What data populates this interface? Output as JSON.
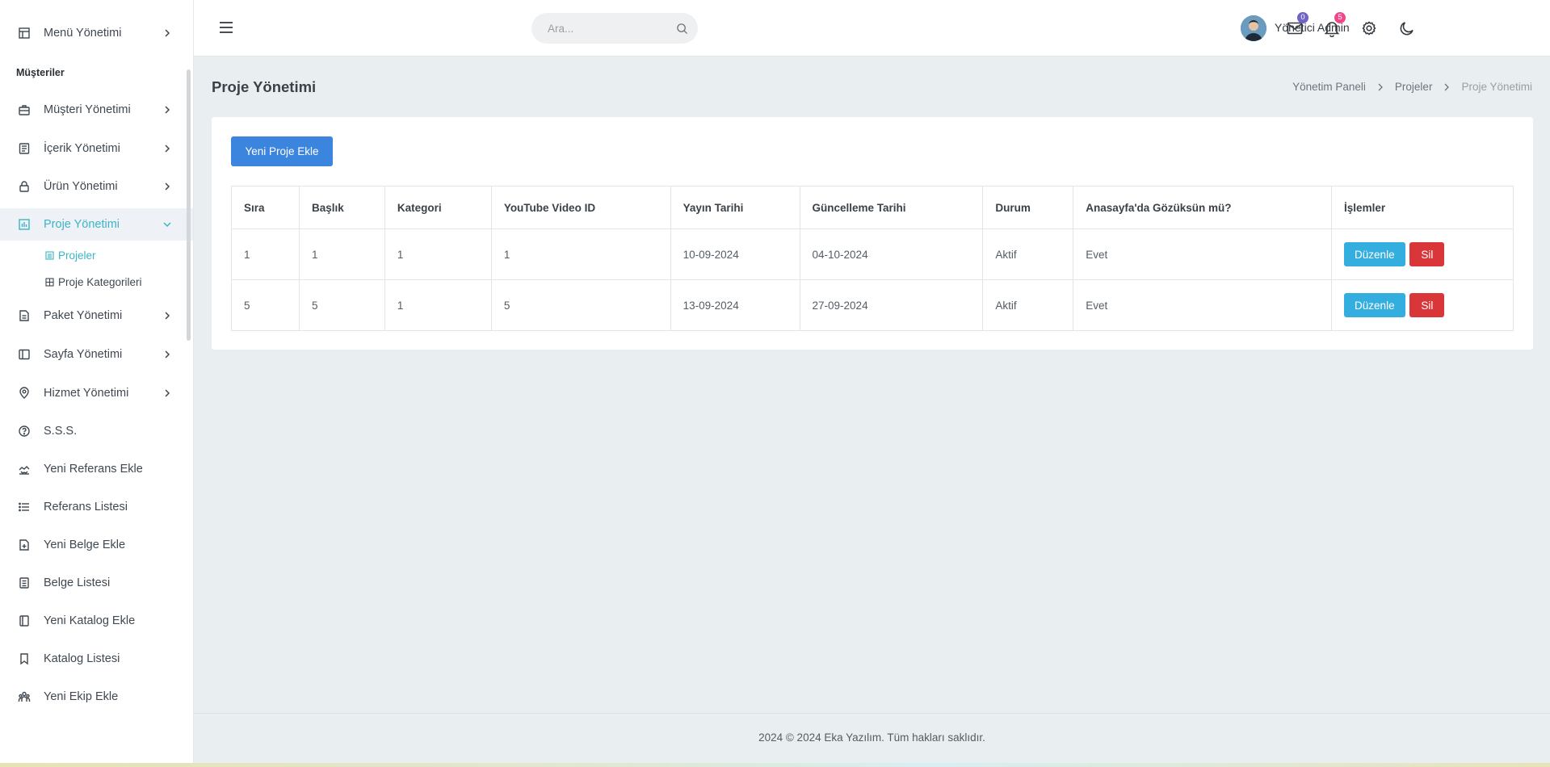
{
  "sidebar": {
    "top_item": "Menü Yönetimi",
    "section": "Müşteriler",
    "items": [
      {
        "label": "Müşteri Yönetimi"
      },
      {
        "label": "İçerik Yönetimi"
      },
      {
        "label": "Ürün Yönetimi"
      },
      {
        "label": "Proje Yönetimi"
      },
      {
        "label": "Paket Yönetimi"
      },
      {
        "label": "Sayfa Yönetimi"
      },
      {
        "label": "Hizmet Yönetimi"
      },
      {
        "label": "S.S.S."
      },
      {
        "label": "Yeni Referans Ekle"
      },
      {
        "label": "Referans Listesi"
      },
      {
        "label": "Yeni Belge Ekle"
      },
      {
        "label": "Belge Listesi"
      },
      {
        "label": "Yeni Katalog Ekle"
      },
      {
        "label": "Katalog Listesi"
      },
      {
        "label": "Yeni Ekip Ekle"
      }
    ],
    "sub_items": [
      {
        "label": "Projeler"
      },
      {
        "label": "Proje Kategorileri"
      }
    ],
    "accent_color": "#3cb4c7"
  },
  "header": {
    "search_placeholder": "Ara...",
    "mail_badge": "0",
    "notification_badge": "5",
    "user_name": "Yönetici Admin"
  },
  "page": {
    "title": "Proje Yönetimi",
    "breadcrumb": [
      "Yönetim Paneli",
      "Projeler",
      "Proje Yönetimi"
    ],
    "add_button": "Yeni Proje Ekle"
  },
  "table": {
    "headers": [
      "Sıra",
      "Başlık",
      "Kategori",
      "YouTube Video ID",
      "Yayın Tarihi",
      "Güncelleme Tarihi",
      "Durum",
      "Anasayfa'da Gözüksün mü?",
      "İşlemler"
    ],
    "rows": [
      {
        "order": "1",
        "title": "1",
        "category": "1",
        "youtube_id": "1",
        "published": "10-09-2024",
        "updated": "04-10-2024",
        "status": "Aktif",
        "homepage": "Evet",
        "edit": "Düzenle",
        "delete": "Sil"
      },
      {
        "order": "5",
        "title": "5",
        "category": "1",
        "youtube_id": "5",
        "published": "13-09-2024",
        "updated": "27-09-2024",
        "status": "Aktif",
        "homepage": "Evet",
        "edit": "Düzenle",
        "delete": "Sil"
      }
    ]
  },
  "footer": {
    "text": "2024 © 2024 Eka Yazılım. Tüm hakları saklıdır."
  },
  "colors": {
    "primary_button": "#3c85de",
    "edit_button": "#33aedf",
    "delete_button": "#d9363a",
    "mail_badge": "#6f63c6",
    "notification_badge": "#f0478a"
  }
}
